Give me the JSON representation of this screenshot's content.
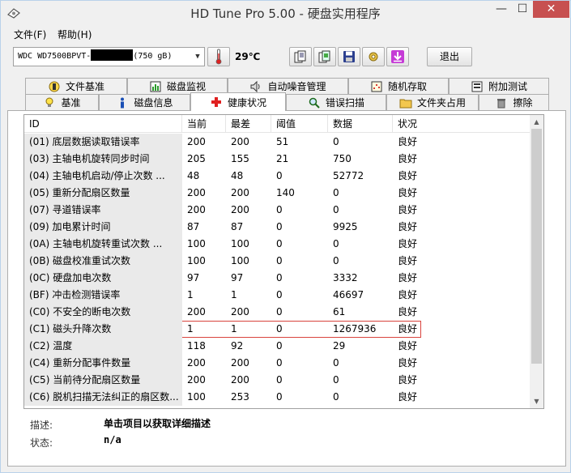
{
  "window": {
    "title": "HD Tune Pro 5.00 - 硬盘实用程序",
    "minimize_glyph": "—",
    "maximize_glyph": "☐",
    "close_glyph": "✕"
  },
  "menu": {
    "file": "文件(F)",
    "help": "帮助(H)"
  },
  "toolbar": {
    "drive_prefix": "WDC WD7500BPVT-",
    "drive_suffix": "(750 gB)",
    "temperature": "29℃",
    "exit_label": "退出",
    "icons": [
      "thermometer-icon",
      "copy-text-icon",
      "copy-screen-icon",
      "save-icon",
      "options-icon",
      "download-icon"
    ]
  },
  "tabs": {
    "row1": [
      "文件基准",
      "磁盘监视",
      "自动噪音管理",
      "随机存取",
      "附加测试"
    ],
    "row2": [
      "基准",
      "磁盘信息",
      "健康状况",
      "错误扫描",
      "文件夹占用",
      "擦除"
    ],
    "active": "健康状况"
  },
  "table": {
    "columns": [
      "ID",
      "当前",
      "最差",
      "阈值",
      "数据",
      "状况"
    ],
    "rows": [
      [
        "(01) 底层数据读取错误率",
        "200",
        "200",
        "51",
        "0",
        "良好"
      ],
      [
        "(03) 主轴电机旋转同步时间",
        "205",
        "155",
        "21",
        "750",
        "良好"
      ],
      [
        "(04) 主轴电机启动/停止次数      ...",
        "48",
        "48",
        "0",
        "52772",
        "良好"
      ],
      [
        "(05) 重新分配扇区数量",
        "200",
        "200",
        "140",
        "0",
        "良好"
      ],
      [
        "(07) 寻道错误率",
        "200",
        "200",
        "0",
        "0",
        "良好"
      ],
      [
        "(09) 加电累计时间",
        "87",
        "87",
        "0",
        "9925",
        "良好"
      ],
      [
        "(0A) 主轴电机旋转重试次数      ...",
        "100",
        "100",
        "0",
        "0",
        "良好"
      ],
      [
        "(0B) 磁盘校准重试次数",
        "100",
        "100",
        "0",
        "0",
        "良好"
      ],
      [
        "(0C) 硬盘加电次数",
        "97",
        "97",
        "0",
        "3332",
        "良好"
      ],
      [
        "(BF) 冲击检测错误率",
        "1",
        "1",
        "0",
        "46697",
        "良好"
      ],
      [
        "(C0) 不安全的断电次数",
        "200",
        "200",
        "0",
        "61",
        "良好"
      ],
      [
        "(C1) 磁头升降次数",
        "1",
        "1",
        "0",
        "1267936",
        "良好"
      ],
      [
        "(C2) 温度",
        "118",
        "92",
        "0",
        "29",
        "良好"
      ],
      [
        "(C4) 重新分配事件数量",
        "200",
        "200",
        "0",
        "0",
        "良好"
      ],
      [
        "(C5) 当前待分配扇区数量",
        "200",
        "200",
        "0",
        "0",
        "良好"
      ],
      [
        "(C6) 脱机扫描无法纠正的扇区数...",
        "100",
        "253",
        "0",
        "0",
        "良好"
      ]
    ],
    "selected_index": 11
  },
  "footer": {
    "desc_label": "描述:",
    "desc_value": "单击项目以获取详细描述",
    "status_label": "状态:",
    "status_value": "n/a"
  }
}
